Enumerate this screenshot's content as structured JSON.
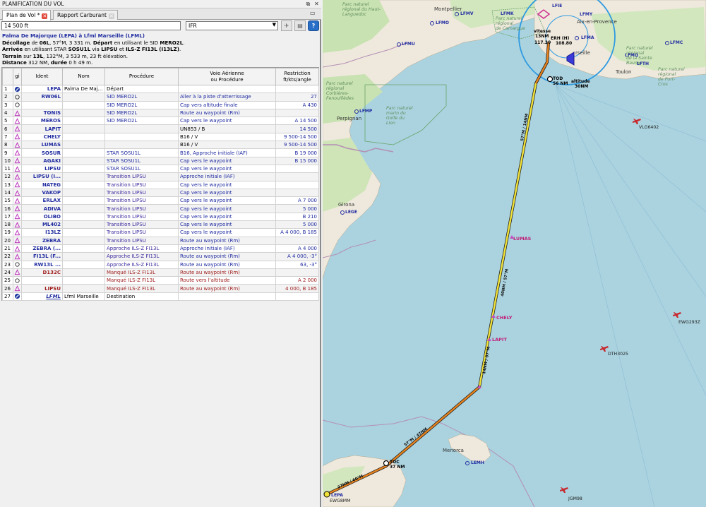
{
  "window": {
    "title": "PLANIFICATION DU VOL"
  },
  "tabs": [
    {
      "label": "Plan de Vol *",
      "active": true
    },
    {
      "label": "Rapport Carburant",
      "active": false
    }
  ],
  "toolbar": {
    "altitude_value": "14 500 ft",
    "flight_rules": "IFR"
  },
  "summary": {
    "line1": "Palma De Majorque (LEPA) à Lfml Marseille (LFML)",
    "departure": {
      "label_takeoff": "Décollage",
      "de": "de",
      "runway": "06L",
      "rwy_details": ", 57°M, 3 331 m.",
      "label_dep": "Départ",
      "using": "en utilisant le SID",
      "sid": "MERO2L",
      "end": "."
    },
    "arrival": {
      "label": "Arrivée",
      "using": "en utilisant STAR",
      "star": "SOSU1L",
      "via": "via",
      "trans": "LIPSU",
      "and": "et",
      "approach": "ILS-Z FI13L (I13LZ)",
      "end": "."
    },
    "terrain": {
      "label": "Terrain",
      "on": "sur",
      "runway": "13L",
      "details": ", 132°M, 3 533 m, 23 ft élévation."
    },
    "distance": {
      "label": "Distance",
      "value": "312 NM",
      "sep": ",",
      "dur_label": "durée",
      "dur_value": "0 h 49 m",
      "end": "."
    }
  },
  "table": {
    "headers": {
      "g": "gi",
      "ident": "Ident",
      "name": "Nom",
      "procedure": "Procédure",
      "airway": "Voie Aérienne\nou Procédure",
      "restriction": "Restriction\nft/kts/angle"
    },
    "rows": [
      {
        "n": "1",
        "icon": "airport",
        "ident": "LEPA",
        "name": "Palma De Maj...",
        "proc": "Départ",
        "proc_c": "black",
        "airway": "",
        "restr": ""
      },
      {
        "n": "2",
        "icon": "runway",
        "ident": "RW06L",
        "name": "",
        "proc": "SID MERO2L",
        "proc_c": "blue",
        "airway": "Aller à la piste d'atterrissage",
        "restr": "27"
      },
      {
        "n": "3",
        "icon": "circle",
        "ident": "",
        "name": "",
        "proc": "SID MERO2L",
        "proc_c": "blue",
        "airway": "Cap vers altitude finale",
        "restr": "A 430"
      },
      {
        "n": "4",
        "icon": "tri",
        "ident": "TONIS",
        "name": "",
        "proc": "SID MERO2L",
        "proc_c": "blue",
        "airway": "Route au waypoint (Rm)",
        "restr": ""
      },
      {
        "n": "5",
        "icon": "tri",
        "ident": "MEROS",
        "name": "",
        "proc": "SID MERO2L",
        "proc_c": "blue",
        "airway": "Cap vers le waypoint",
        "restr": "A 14 500"
      },
      {
        "n": "6",
        "icon": "tri",
        "ident": "LAPIT",
        "name": "",
        "proc": "",
        "proc_c": "black",
        "airway": "UN853 / B",
        "restr": "14 500"
      },
      {
        "n": "7",
        "icon": "tri",
        "ident": "CHELY",
        "name": "",
        "proc": "",
        "proc_c": "black",
        "airway": "B16 / V",
        "restr": "9 500-14 500"
      },
      {
        "n": "8",
        "icon": "tri",
        "ident": "LUMAS",
        "name": "",
        "proc": "",
        "proc_c": "black",
        "airway": "B16 / V",
        "restr": "9 500-14 500"
      },
      {
        "n": "9",
        "icon": "tri",
        "ident": "SOSUR",
        "name": "",
        "proc": "STAR SOSU1L",
        "proc_c": "blue",
        "airway": "B16, Approche initiale (IAF)",
        "restr": "B 19 000"
      },
      {
        "n": "10",
        "icon": "tri",
        "ident": "AGAKI",
        "name": "",
        "proc": "STAR SOSU1L",
        "proc_c": "blue",
        "airway": "Cap vers le waypoint",
        "restr": "B 15 000"
      },
      {
        "n": "11",
        "icon": "tri",
        "ident": "LIPSU",
        "name": "",
        "proc": "STAR SOSU1L",
        "proc_c": "blue",
        "airway": "Cap vers le waypoint",
        "restr": ""
      },
      {
        "n": "12",
        "icon": "tri",
        "ident": "LIPSU (I...",
        "name": "",
        "proc": "Transition LIPSU",
        "proc_c": "purple",
        "airway": "Approche initiale (IAF)",
        "restr": ""
      },
      {
        "n": "13",
        "icon": "tri",
        "ident": "NATEG",
        "name": "",
        "proc": "Transition LIPSU",
        "proc_c": "purple",
        "airway": "Cap vers le waypoint",
        "restr": ""
      },
      {
        "n": "14",
        "icon": "tri",
        "ident": "VAKOP",
        "name": "",
        "proc": "Transition LIPSU",
        "proc_c": "purple",
        "airway": "Cap vers le waypoint",
        "restr": ""
      },
      {
        "n": "15",
        "icon": "tri",
        "ident": "ERLAX",
        "name": "",
        "proc": "Transition LIPSU",
        "proc_c": "purple",
        "airway": "Cap vers le waypoint",
        "restr": "A 7 000"
      },
      {
        "n": "16",
        "icon": "tri",
        "ident": "ADIVA",
        "name": "",
        "proc": "Transition LIPSU",
        "proc_c": "purple",
        "airway": "Cap vers le waypoint",
        "restr": "5 000"
      },
      {
        "n": "17",
        "icon": "tri",
        "ident": "OLIBO",
        "name": "",
        "proc": "Transition LIPSU",
        "proc_c": "purple",
        "airway": "Cap vers le waypoint",
        "restr": "B 210"
      },
      {
        "n": "18",
        "icon": "tri",
        "ident": "ML402",
        "name": "",
        "proc": "Transition LIPSU",
        "proc_c": "purple",
        "airway": "Cap vers le waypoint",
        "restr": "5 000"
      },
      {
        "n": "19",
        "icon": "tri",
        "ident": "I13LZ",
        "name": "",
        "proc": "Transition LIPSU",
        "proc_c": "purple",
        "airway": "Cap vers le waypoint",
        "restr": "A 4 000, B 185"
      },
      {
        "n": "20",
        "icon": "tri",
        "ident": "ZEBRA",
        "name": "",
        "proc": "Transition LIPSU",
        "proc_c": "purple",
        "airway": "Route au waypoint (Rm)",
        "restr": ""
      },
      {
        "n": "21",
        "icon": "tri",
        "ident": "ZEBRA (...",
        "name": "",
        "proc": "Approche ILS-Z FI13L",
        "proc_c": "purple",
        "airway": "Approche initiale (IAF)",
        "restr": "A 4 000"
      },
      {
        "n": "22",
        "icon": "tri",
        "ident": "FI13L (F...",
        "name": "",
        "proc": "Approche ILS-Z FI13L",
        "proc_c": "purple",
        "airway": "Route au waypoint (Rm)",
        "restr": "A 4 000, -3°"
      },
      {
        "n": "23",
        "icon": "runway",
        "ident": "RW13L ...",
        "name": "",
        "proc": "Approche ILS-Z FI13L",
        "proc_c": "purple",
        "airway": "Route au waypoint (Rm)",
        "restr": "63, -3°"
      },
      {
        "n": "24",
        "icon": "tri",
        "ident": "D132C",
        "name": "",
        "proc": "Manqué ILS-Z FI13L",
        "proc_c": "red",
        "airway": "Route au waypoint (Rm)",
        "restr": "",
        "miss": true
      },
      {
        "n": "25",
        "icon": "circle",
        "ident": "",
        "name": "",
        "proc": "Manqué ILS-Z FI13L",
        "proc_c": "red",
        "airway": "Route vers l'altitude",
        "restr": "A 2 000",
        "miss": true
      },
      {
        "n": "26",
        "icon": "tri",
        "ident": "LIPSU",
        "name": "",
        "proc": "Manqué ILS-Z FI13L",
        "proc_c": "red",
        "airway": "Route au waypoint (Rm)",
        "restr": "4 000, B 185",
        "miss": true
      },
      {
        "n": "27",
        "icon": "airport",
        "ident": "LFML",
        "name": "Lfml Marseille",
        "proc": "Destination",
        "proc_c": "black",
        "airway": "",
        "restr": "",
        "dest": true
      }
    ]
  },
  "map": {
    "regions": [
      {
        "text": "Parc naturel\nrégional du Haut-\nLanguedoc"
      },
      {
        "text": "Parc naturel\nrégional\nde Camargue"
      },
      {
        "text": "Parc naturel\nrégional\nCorbières-\nFenouillèdes"
      },
      {
        "text": "Parc naturel\nmarin du\nGolfe du\nLion"
      },
      {
        "text": "Parc naturel\nrégional\nde la Sainte\nBaume"
      },
      {
        "text": "Parc naturel\nrégional\nde Port-\nCros"
      }
    ],
    "places": {
      "montpellier": "Montpellier",
      "marseille": "rseille",
      "toulon": "Toulon",
      "aix": "Aix-en-Provence",
      "perpignan": "Perpignan",
      "girona": "Girona",
      "menorca": "Menorca"
    },
    "airports": [
      "LFMV",
      "LFMO",
      "LFMU",
      "LFMK",
      "LFMP",
      "LFMY",
      "LFMA",
      "LFMQ",
      "LFMC",
      "LFTH",
      "LFIE",
      "LEGE",
      "LEMH"
    ],
    "route_labels": [
      "LUMAS",
      "CHELY",
      "LAPIT"
    ],
    "leg_labels": [
      "57°M / 14NM",
      "57°M / 47NM",
      "40NM / 57°M",
      "14NM / 57°M",
      "27NM / 60°M"
    ],
    "markers": {
      "tod": {
        "label": "TOD",
        "dist": "56 NM"
      },
      "toc": {
        "label": "TOC",
        "dist": "37 NM"
      },
      "alt": {
        "label": "altitude",
        "dist": "30NM"
      },
      "speed": {
        "label": "vitesse",
        "dist": "13NM"
      },
      "lfml_info": {
        "l1": "ERH (H)",
        "l2": "108.80",
        "l3": "117.30"
      }
    },
    "aircraft": [
      "VLG6402",
      "EWG293Z",
      "DTH3025",
      "JGM98",
      "EWG8MM"
    ],
    "lepa_label": "LEPA"
  }
}
